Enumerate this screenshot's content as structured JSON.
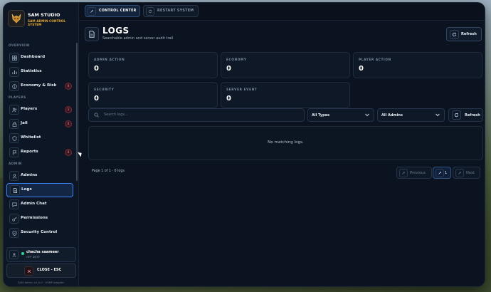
{
  "brand": {
    "title": "SAM STUDIO",
    "subtitle": "SAM ADMIN CONTROL SYSTEM"
  },
  "sidebar": {
    "sections": [
      {
        "label": "OVERVIEW"
      },
      {
        "label": "PLAYERS"
      },
      {
        "label": "ADMIN"
      }
    ],
    "items": [
      {
        "label": "Dashboard",
        "icon": "dashboard-icon"
      },
      {
        "label": "Statistics",
        "icon": "bar-chart-icon"
      },
      {
        "label": "Economy & Risk",
        "icon": "dollar-icon",
        "badge": "0"
      },
      {
        "label": "Players",
        "icon": "users-icon",
        "badge": "1"
      },
      {
        "label": "Jail",
        "icon": "lock-icon",
        "badge": "0"
      },
      {
        "label": "Whitelist",
        "icon": "shield-icon"
      },
      {
        "label": "Reports",
        "icon": "flag-icon",
        "badge": "0"
      },
      {
        "label": "Admins",
        "icon": "person-star-icon"
      },
      {
        "label": "Logs",
        "icon": "document-icon",
        "active": true
      },
      {
        "label": "Admin Chat",
        "icon": "chat-icon"
      },
      {
        "label": "Permissions",
        "icon": "key-icon"
      },
      {
        "label": "Security Control",
        "icon": "security-icon"
      }
    ],
    "user": {
      "name": "chacha saameer",
      "status": "OFF DUTY"
    },
    "close_label": "CLOSE - ESC",
    "version": "SAM Admin v1.0.0 · VORP Adapter"
  },
  "topbar": {
    "control_center": "CONTROL CENTER",
    "restart_system": "RESTART SYSTEM"
  },
  "header": {
    "title": "LOGS",
    "subtitle": "Searchable admin and server audit trail",
    "refresh_label": "Refresh"
  },
  "stats": [
    {
      "label": "ADMIN ACTION",
      "value": "0"
    },
    {
      "label": "ECONOMY",
      "value": "0"
    },
    {
      "label": "PLAYER ACTION",
      "value": "0"
    },
    {
      "label": "SECURITY",
      "value": "0"
    },
    {
      "label": "SERVER EVENT",
      "value": "0"
    }
  ],
  "filters": {
    "search_placeholder": "Search logs...",
    "type_selected": "All Types",
    "admin_selected": "All Admins",
    "refresh_label": "Refresh"
  },
  "table": {
    "empty_message": "No matching logs."
  },
  "pagination": {
    "info": "Page 1 of 1 · 0 logs",
    "previous": "Previous",
    "current": "1",
    "next": "Next"
  },
  "colors": {
    "accent": "#3b82f6",
    "brand_gold": "#e2a533",
    "panel": "#0b1320",
    "badge": "#ff8a96",
    "online": "#34d399"
  }
}
